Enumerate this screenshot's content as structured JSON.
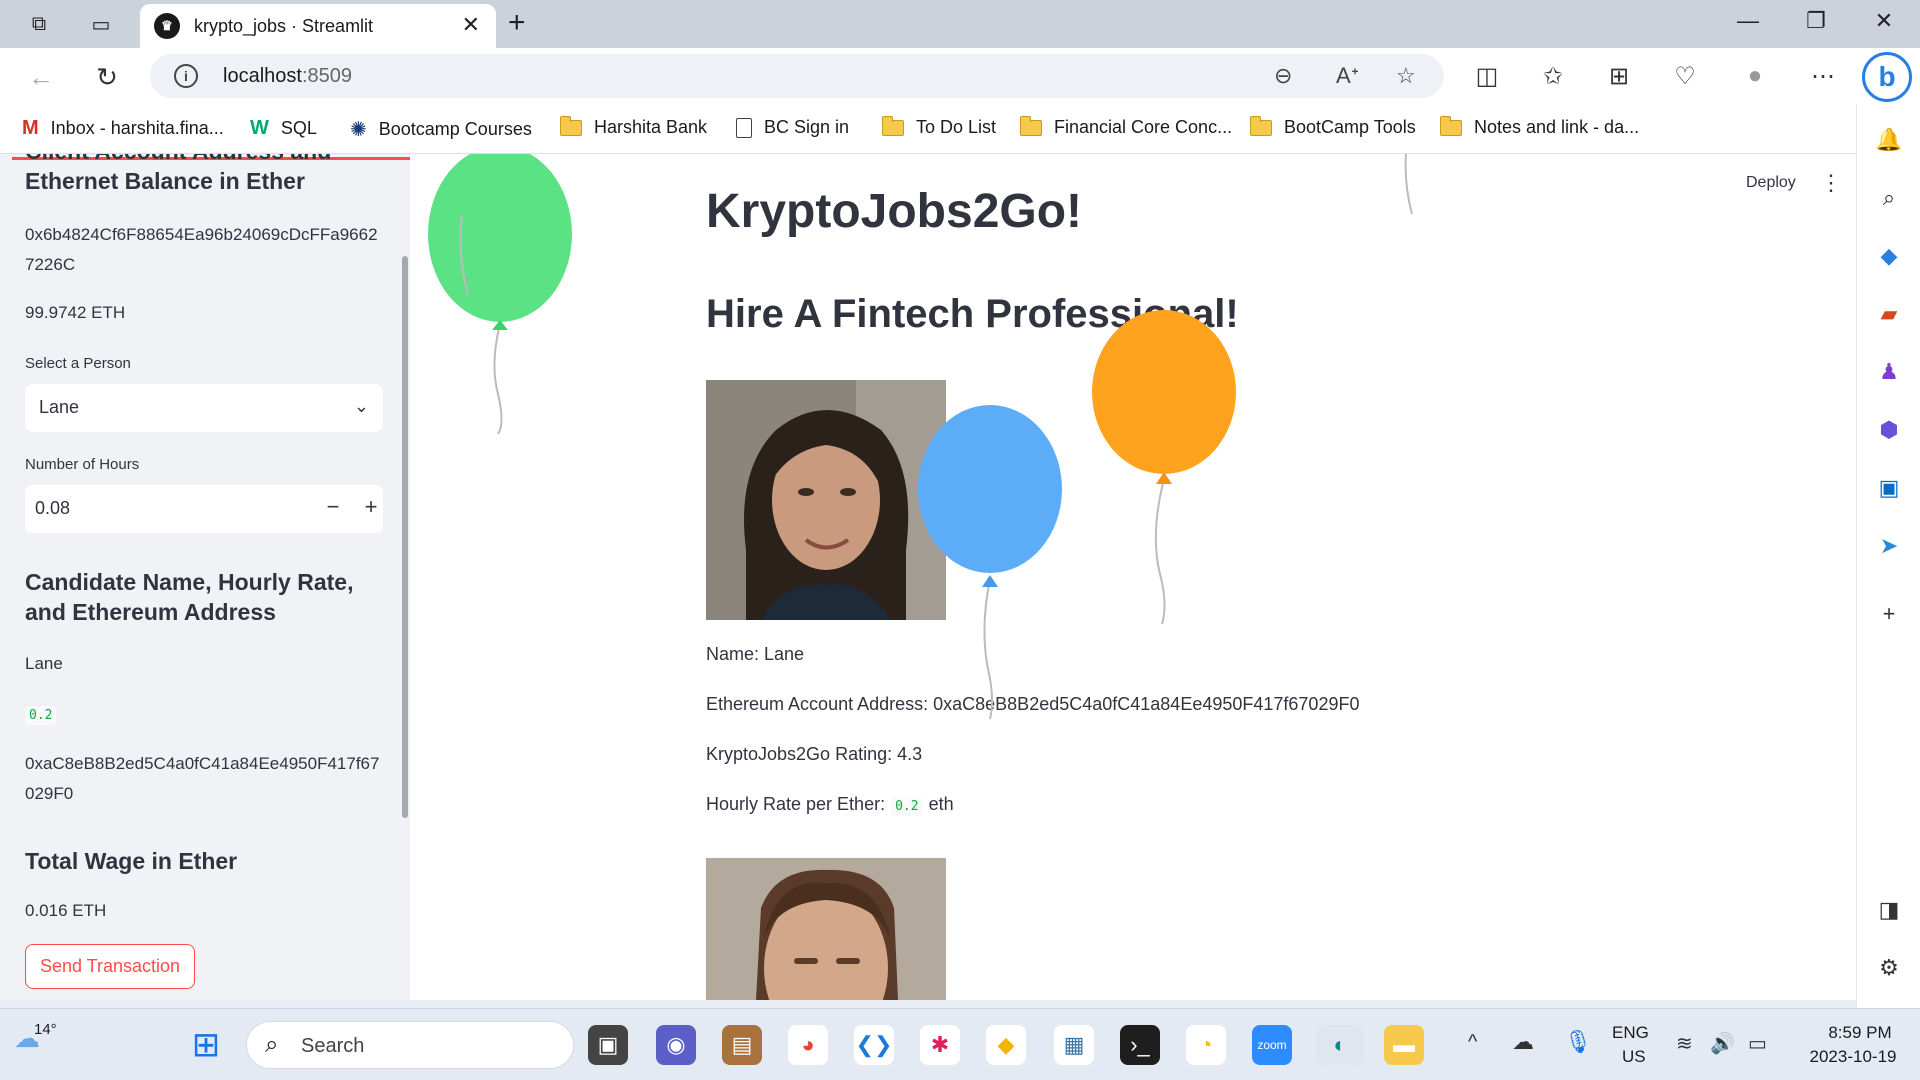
{
  "browser": {
    "tab_title": "krypto_jobs · Streamlit",
    "url_host": "localhost",
    "url_port": ":8509"
  },
  "bookmarks": [
    {
      "label": "Inbox - harshita.fina...",
      "icon": "gmail-icon"
    },
    {
      "label": "SQL",
      "icon": "w3schools-icon"
    },
    {
      "label": "Bootcamp Courses",
      "icon": "bootcamp-icon"
    },
    {
      "label": "Harshita Bank",
      "icon": "folder-icon"
    },
    {
      "label": "BC Sign in",
      "icon": "page-icon"
    },
    {
      "label": "To Do List",
      "icon": "folder-icon"
    },
    {
      "label": "Financial Core Conc...",
      "icon": "folder-icon"
    },
    {
      "label": "BootCamp Tools",
      "icon": "folder-icon"
    },
    {
      "label": "Notes and link - da...",
      "icon": "folder-icon"
    }
  ],
  "sidebar": {
    "client_heading": "Client Account Address and Ethernet Balance in Ether",
    "client_address": "0x6b4824Cf6F88654Ea96b24069cDcFFa96627226C",
    "client_balance": "99.9742 ETH",
    "select_label": "Select a Person",
    "select_value": "Lane",
    "hours_label": "Number of Hours",
    "hours_value": "0.08",
    "hours_minus": "−",
    "hours_plus": "+",
    "candidate_heading": "Candidate Name, Hourly Rate, and Ethereum Address",
    "candidate_name": "Lane",
    "candidate_rate": "0.2",
    "candidate_address": "0xaC8eB8B2ed5C4a0fC41a84Ee4950F417f67029F0",
    "wage_heading": "Total Wage in Ether",
    "wage_value": "0.016 ETH",
    "send_button": "Send Transaction"
  },
  "main": {
    "deploy": "Deploy",
    "title": "KryptoJobs2Go!",
    "subtitle": "Hire A Fintech Professional!",
    "name_line": "Name: Lane",
    "address_line": "Ethereum Account Address: 0xaC8eB8B2ed5C4a0fC41a84Ee4950F417f67029F0",
    "rating_line": "KryptoJobs2Go Rating: 4.3",
    "rate_prefix": "Hourly Rate per Ether:",
    "rate_value": "0.2",
    "rate_suffix": "eth"
  },
  "taskbar": {
    "weather_temp": "14°",
    "search_placeholder": "Search",
    "lang_line1": "ENG",
    "lang_line2": "US",
    "time": "8:59 PM",
    "date": "2023-10-19"
  },
  "colors": {
    "accent_red": "#ff4b4b",
    "code_green": "#09ab3b",
    "balloon_green": "#5ae284",
    "balloon_blue": "#5cacf7",
    "balloon_orange": "#ffa31e"
  }
}
